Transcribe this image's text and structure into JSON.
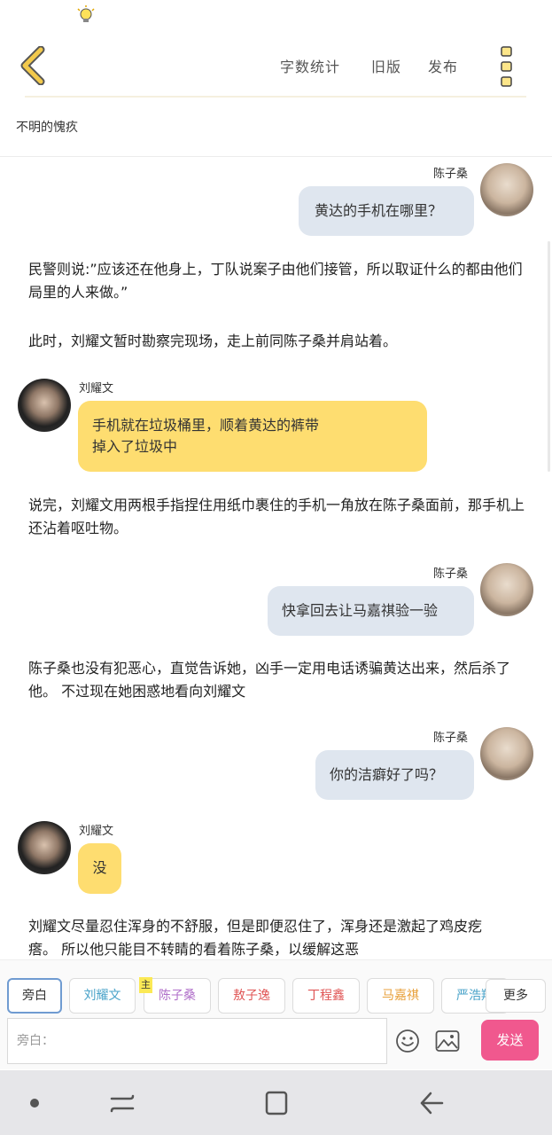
{
  "toolbar": {
    "word_count": "字数统计",
    "old_version": "旧版",
    "publish": "发布"
  },
  "story": {
    "title": "不明的愧疚"
  },
  "messages": [
    {
      "type": "dialogue",
      "side": "right",
      "speaker": "陈子桑",
      "text": "黄达的手机在哪里？"
    },
    {
      "type": "narration",
      "text": "民警则说:”应该还在他身上，丁队说案子由他们接管，所以取证什么的都由他们局里的人来做。”"
    },
    {
      "type": "narration",
      "text": "此时，刘耀文暂时勘察完现场，走上前同陈子桑并肩站着。"
    },
    {
      "type": "dialogue",
      "side": "left",
      "speaker": "刘耀文",
      "text_line1": "手机就在垃圾桶里，顺着黄达的裤带",
      "text_line2": "掉入了垃圾中"
    },
    {
      "type": "narration",
      "text": "说完，刘耀文用两根手指捏住用纸巾裹住的手机一角放在陈子桑面前，那手机上还沾着呕吐物。"
    },
    {
      "type": "dialogue",
      "side": "right",
      "speaker": "陈子桑",
      "text": "快拿回去让马嘉祺验一验"
    },
    {
      "type": "narration",
      "text": "陈子桑也没有犯恶心，直觉告诉她，凶手一定用电话诱骗黄达出来，然后杀了他。 不过现在她困惑地看向刘耀文"
    },
    {
      "type": "dialogue",
      "side": "right",
      "speaker": "陈子桑",
      "text": "你的洁癖好了吗？"
    },
    {
      "type": "dialogue",
      "side": "left",
      "speaker": "刘耀文",
      "text": "没"
    },
    {
      "type": "narration",
      "text": "刘耀文尽量忍住浑身的不舒服，但是即便忍住了，浑身还是激起了鸡皮疙瘩。 所以他只能目不转睛的看着陈子桑，以缓解这恶"
    }
  ],
  "characters": [
    {
      "label": "旁白",
      "color": "#333333",
      "active": true
    },
    {
      "label": "刘耀文",
      "color": "#4aa3c9"
    },
    {
      "label": "陈子桑",
      "color": "#b06fc9",
      "badge": "主"
    },
    {
      "label": "敖子逸",
      "color": "#e05555"
    },
    {
      "label": "丁程鑫",
      "color": "#e05555"
    },
    {
      "label": "马嘉祺",
      "color": "#e8a13c"
    },
    {
      "label": "严浩翔",
      "color": "#4aa3c9"
    }
  ],
  "more_label": "更多",
  "input": {
    "placeholder": "旁白："
  },
  "send_label": "发送",
  "colors": {
    "accent": "#f0588e",
    "left_bubble": "#fedd70",
    "right_bubble": "#dfe6ef",
    "back_arrow": "#f2c94c"
  }
}
